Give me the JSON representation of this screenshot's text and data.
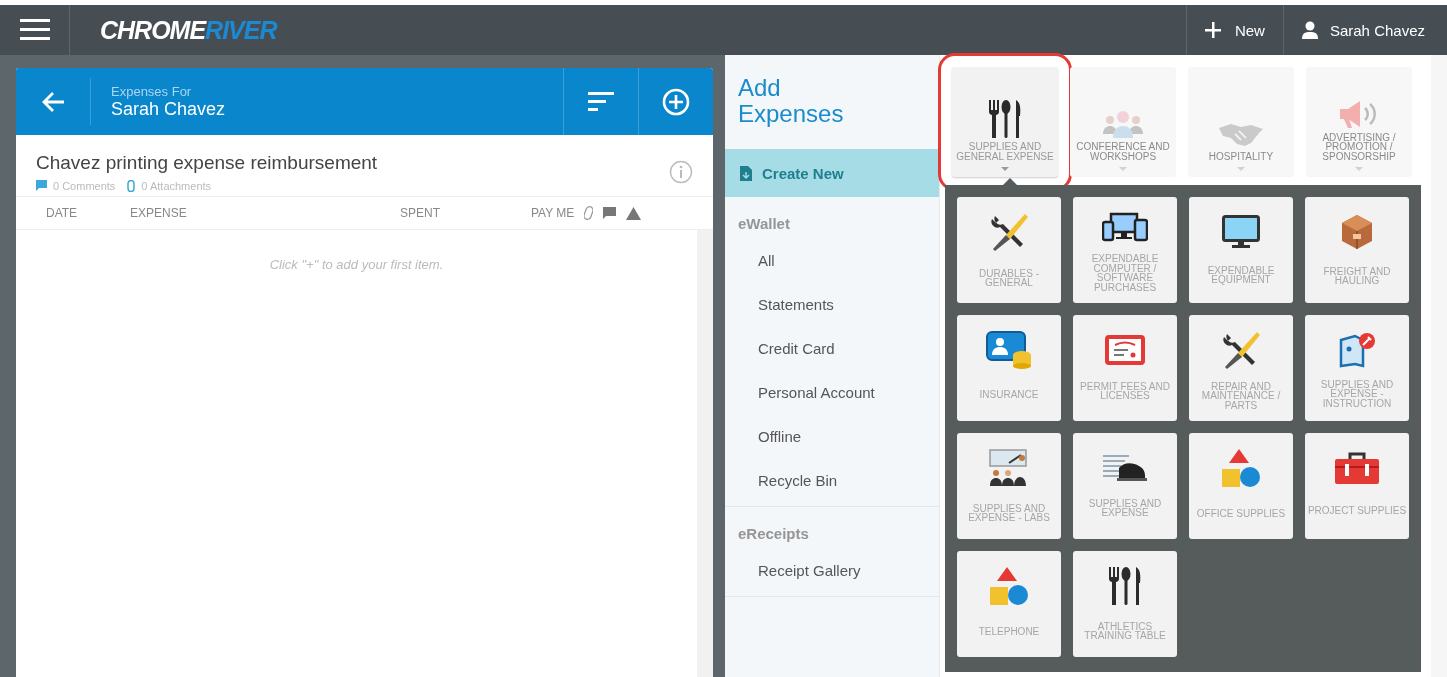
{
  "top_bar": {
    "logo": {
      "first": "CHROME",
      "second": "RIVER"
    },
    "new_button": "New",
    "user": "Sarah Chavez"
  },
  "report_panel": {
    "header": {
      "caption": "Expenses For",
      "name": "Sarah Chavez"
    },
    "title": "Chavez printing expense reimbursement",
    "comments": "0 Comments",
    "attachments": "0 Attachments",
    "columns": [
      "DATE",
      "EXPENSE",
      "SPENT",
      "PAY ME"
    ],
    "empty_message": "Click \"+\" to add your first item."
  },
  "sidebar": {
    "title": "Add Expenses",
    "create_new": {
      "label": "Create New",
      "selected": true
    },
    "sections": [
      {
        "label": "eWallet",
        "items": [
          {
            "label": "All",
            "selected": false
          },
          {
            "label": "Statements",
            "selected": false
          },
          {
            "label": "Credit Card",
            "selected": false
          },
          {
            "label": "Personal Account",
            "selected": false
          },
          {
            "label": "Offline",
            "selected": false
          },
          {
            "label": "Recycle Bin",
            "selected": false
          }
        ]
      },
      {
        "label": "eReceipts",
        "items": [
          {
            "label": "Receipt Gallery",
            "selected": false
          }
        ]
      }
    ]
  },
  "categories": [
    {
      "label": "SUPPLIES AND GENERAL EXPENSE",
      "kind": "utensils",
      "selected": true
    },
    {
      "label": "CONFERENCE AND WORKSHOPS",
      "kind": "people",
      "selected": false
    },
    {
      "label": "HOSPITALITY",
      "kind": "handshake",
      "selected": false
    },
    {
      "label": "ADVERTISING / PROMOTION / SPONSORSHIP",
      "kind": "megaphone",
      "selected": false
    }
  ],
  "subcategories": [
    {
      "label": "DURABLES - GENERAL",
      "kind": "tools"
    },
    {
      "label": "EXPENDABLE COMPUTER / SOFTWARE PURCHASES",
      "kind": "devices"
    },
    {
      "label": "EXPENDABLE EQUIPMENT",
      "kind": "monitor"
    },
    {
      "label": "FREIGHT AND HAULING",
      "kind": "box"
    },
    {
      "label": "INSURANCE",
      "kind": "card-coins"
    },
    {
      "label": "PERMIT FEES AND LICENSES",
      "kind": "certificate"
    },
    {
      "label": "REPAIR AND MAINTENANCE / PARTS",
      "kind": "tools"
    },
    {
      "label": "SUPPLIES AND EXPENSE - INSTRUCTION",
      "kind": "box-wrench"
    },
    {
      "label": "SUPPLIES AND EXPENSE - LABS",
      "kind": "classroom"
    },
    {
      "label": "SUPPLIES AND EXPENSE",
      "kind": "stapler"
    },
    {
      "label": "OFFICE SUPPLIES",
      "kind": "shapes"
    },
    {
      "label": "PROJECT SUPPLIES",
      "kind": "toolbox"
    },
    {
      "label": "TELEPHONE",
      "kind": "shapes"
    },
    {
      "label": "ATHLETICS TRAINING TABLE",
      "kind": "utensils"
    }
  ]
}
